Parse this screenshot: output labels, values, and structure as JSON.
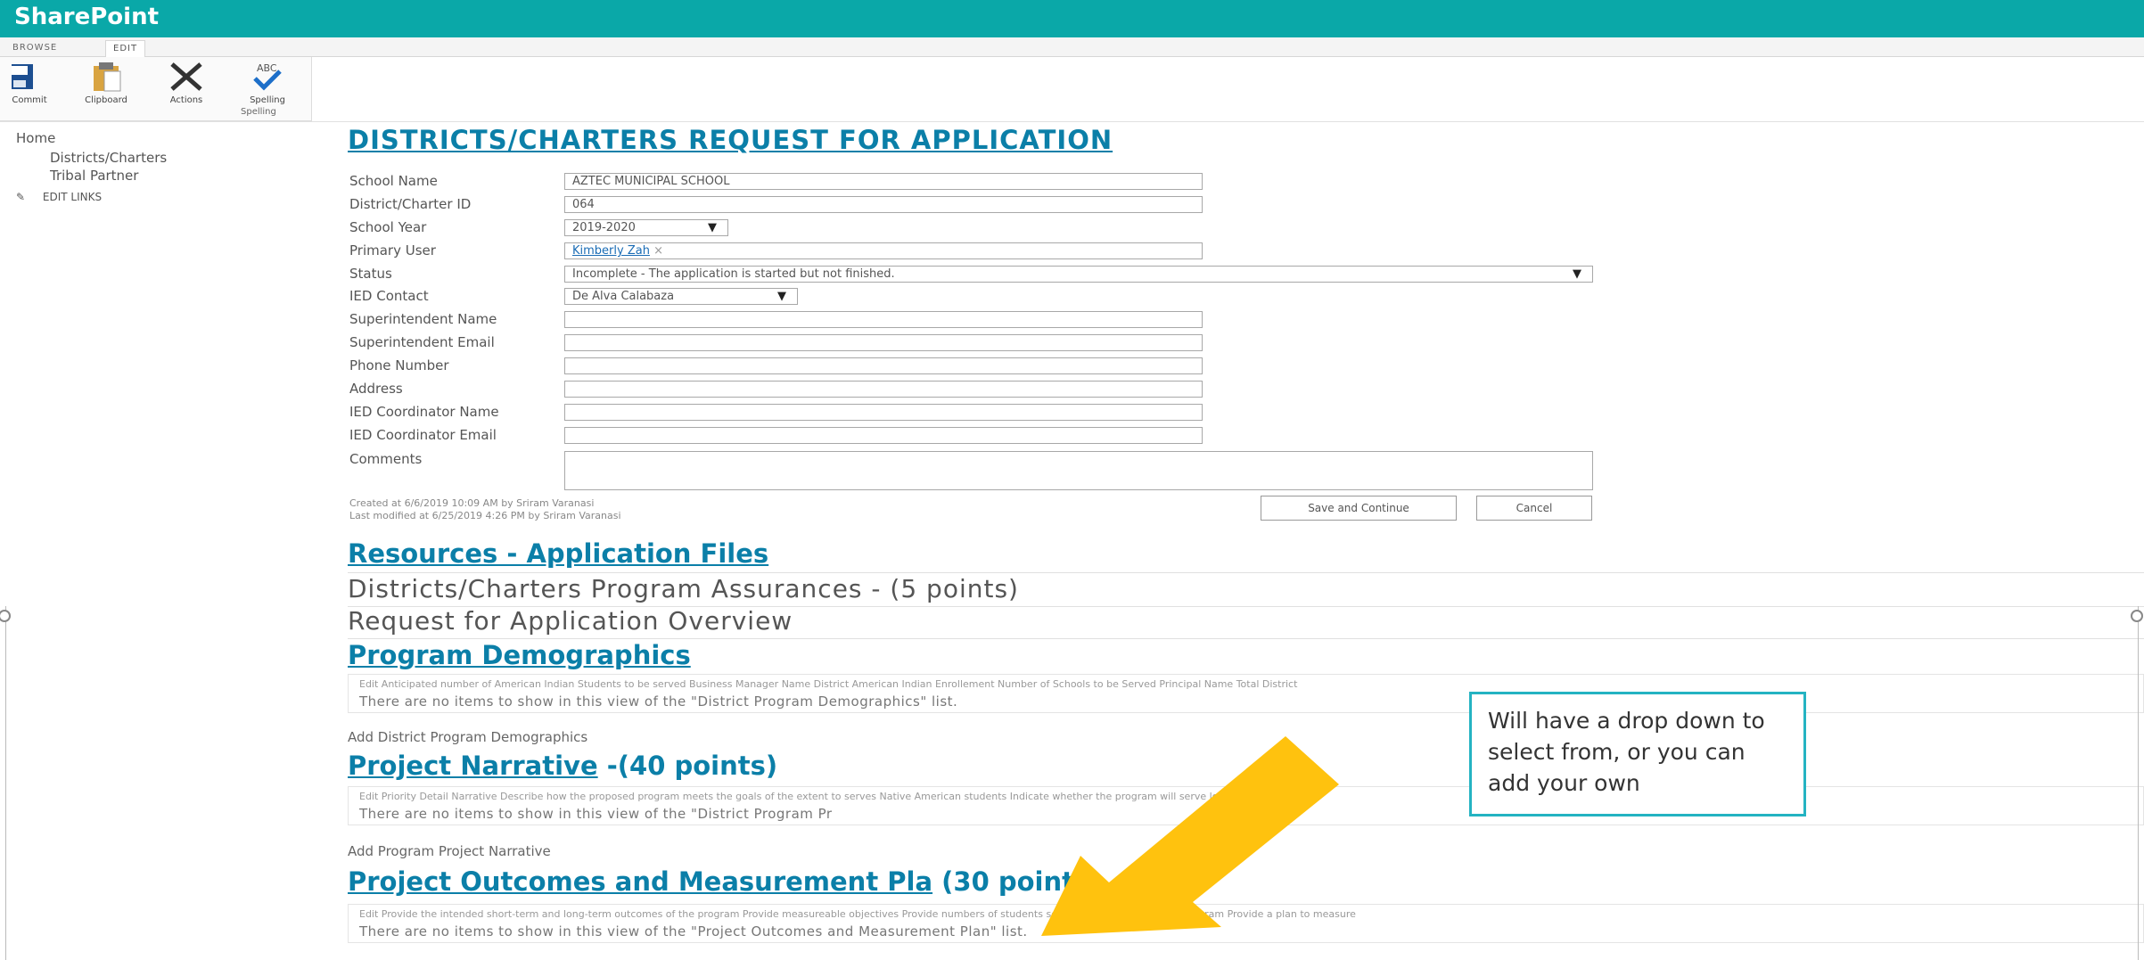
{
  "app": {
    "brand": "SharePoint"
  },
  "ribbon": {
    "tabs": [
      "BROWSE",
      "EDIT"
    ],
    "buttons": [
      "Commit",
      "Clipboard",
      "Actions",
      "Spelling"
    ],
    "group_label": "Spelling"
  },
  "quicklaunch": {
    "items": [
      "Home",
      "Districts/Charters",
      "Tribal Partner",
      "EDIT LINKS"
    ]
  },
  "form": {
    "title": "DISTRICTS/CHARTERS REQUEST FOR APPLICATION",
    "fields": [
      {
        "label": "School Name",
        "value": "AZTEC MUNICIPAL SCHOOL"
      },
      {
        "label": "District/Charter ID",
        "value": "064"
      },
      {
        "label": "School Year",
        "value": "2019-2020"
      },
      {
        "label": "Primary User",
        "value": "Kimberly Zah"
      },
      {
        "label": "Status",
        "value": "Incomplete - The application is started but not finished."
      },
      {
        "label": "IED Contact",
        "value": "De Alva Calabaza"
      },
      {
        "label": "Superintendent Name",
        "value": ""
      },
      {
        "label": "Superintendent Email",
        "value": ""
      },
      {
        "label": "Phone Number",
        "value": ""
      },
      {
        "label": "Address",
        "value": ""
      },
      {
        "label": "IED Coordinator Name",
        "value": ""
      },
      {
        "label": "IED Coordinator Email",
        "value": ""
      },
      {
        "label": "Comments",
        "value": ""
      }
    ],
    "created": "Created at 6/6/2019 10:09 AM  by    Sriram Varanasi",
    "modified": "Last modified at 6/25/2019 4:26 PM  by    Sriram Varanasi",
    "save_label": "Save and Continue",
    "cancel_label": "Cancel"
  },
  "sections": {
    "resources": "Resources - Application Files",
    "assurances": "Districts/Charters Program Assurances - (5 points)",
    "overview": "Request for Application Overview",
    "demographics": {
      "title": "Program Demographics",
      "headers": "Edit    Anticipated number of American Indian Students to be served    Business Manager Name    District American Indian Enrollement    Number of Schools to be Served    Principal Name    Total District",
      "empty": "There are no items to show in this view of the \"District Program Demographics\" list.",
      "add": "Add District Program Demographics"
    },
    "narrative": {
      "title": "Project Narrative",
      "points": " -(40 points)",
      "headers": "Edit    Priority    Detail Narrative    Describe how the proposed program meets the goals of the                                                   extent to serves Native American students    Indicate whether the program will serve low-income",
      "empty": "There are no items to show in this view of the \"District Program Pr",
      "add": "Add Program Project Narrative"
    },
    "outcomes": {
      "title": "Project Outcomes and Measurement Pla",
      "points": "  (30 points)",
      "headers": "Edit    Provide the intended short-term and long-term outcomes of the program    Provide measureable objectives    Provide numbers of students served under the proposed program    Provide a plan to measure",
      "empty": "There are no items to show in this view of the \"Project Outcomes and Measurement Plan\" list."
    }
  },
  "callout": {
    "text": "Will have a drop down to select from, or you can add your own"
  },
  "colors": {
    "suite": "#0aa8a8",
    "link": "#0b7fa8",
    "arrow": "#ffc20e",
    "callout_border": "#24b3c2"
  }
}
